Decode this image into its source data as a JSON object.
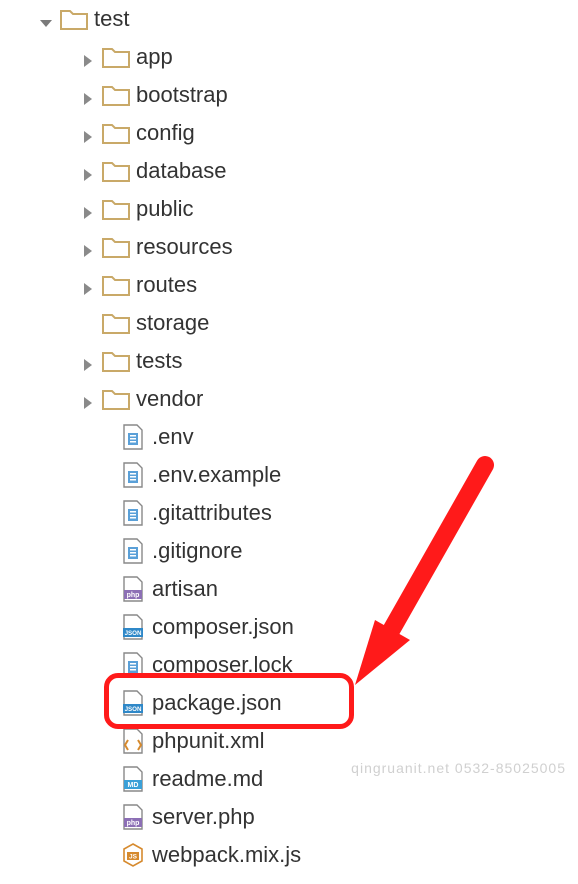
{
  "root": {
    "label": "test",
    "expanded": true
  },
  "folders": [
    {
      "label": "app"
    },
    {
      "label": "bootstrap"
    },
    {
      "label": "config"
    },
    {
      "label": "database"
    },
    {
      "label": "public"
    },
    {
      "label": "resources"
    },
    {
      "label": "routes"
    },
    {
      "label": "storage"
    },
    {
      "label": "tests"
    },
    {
      "label": "vendor"
    }
  ],
  "files": [
    {
      "label": ".env",
      "type": "text"
    },
    {
      "label": ".env.example",
      "type": "text"
    },
    {
      "label": ".gitattributes",
      "type": "text"
    },
    {
      "label": ".gitignore",
      "type": "text"
    },
    {
      "label": "artisan",
      "type": "php"
    },
    {
      "label": "composer.json",
      "type": "json"
    },
    {
      "label": "composer.lock",
      "type": "text"
    },
    {
      "label": "package.json",
      "type": "json",
      "highlighted": true
    },
    {
      "label": "phpunit.xml",
      "type": "xml"
    },
    {
      "label": "readme.md",
      "type": "md"
    },
    {
      "label": "server.php",
      "type": "php"
    },
    {
      "label": "webpack.mix.js",
      "type": "js"
    }
  ],
  "watermark": "qingruanit.net 0532-85025005",
  "colors": {
    "folder": "#c9a968",
    "arrow": "#8a8a8a",
    "highlight": "#ff1a1a"
  }
}
